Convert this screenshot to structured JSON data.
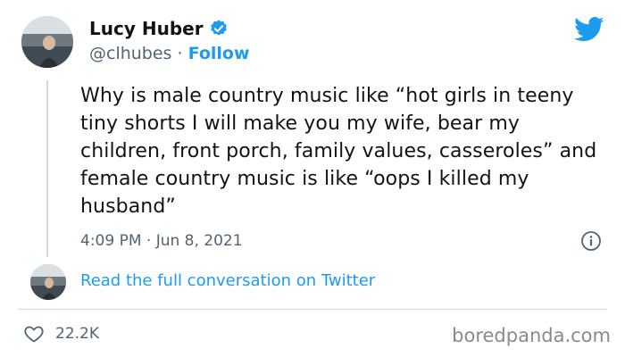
{
  "author": {
    "name": "Lucy Huber",
    "handle": "@clhubes",
    "separator": "·",
    "follow_label": "Follow",
    "verified": true
  },
  "tweet": {
    "text": "Why is male country music like “hot girls in teeny tiny shorts I will make you my wife, bear my children, front porch, family values, casseroles” and female country music is like “oops I killed my husband”",
    "timestamp": "4:09 PM · Jun 8, 2021"
  },
  "conversation": {
    "link_label": "Read the full conversation on Twitter"
  },
  "engagement": {
    "likes": "22.2K"
  },
  "watermark": "boredpanda.com",
  "colors": {
    "accent": "#1d9bf0",
    "text": "#0f1419",
    "muted": "#536471",
    "border": "#cfd9de"
  },
  "icons": {
    "brand": "twitter-bird-icon",
    "verified": "verified-badge-icon",
    "info": "info-icon",
    "like": "heart-icon"
  }
}
